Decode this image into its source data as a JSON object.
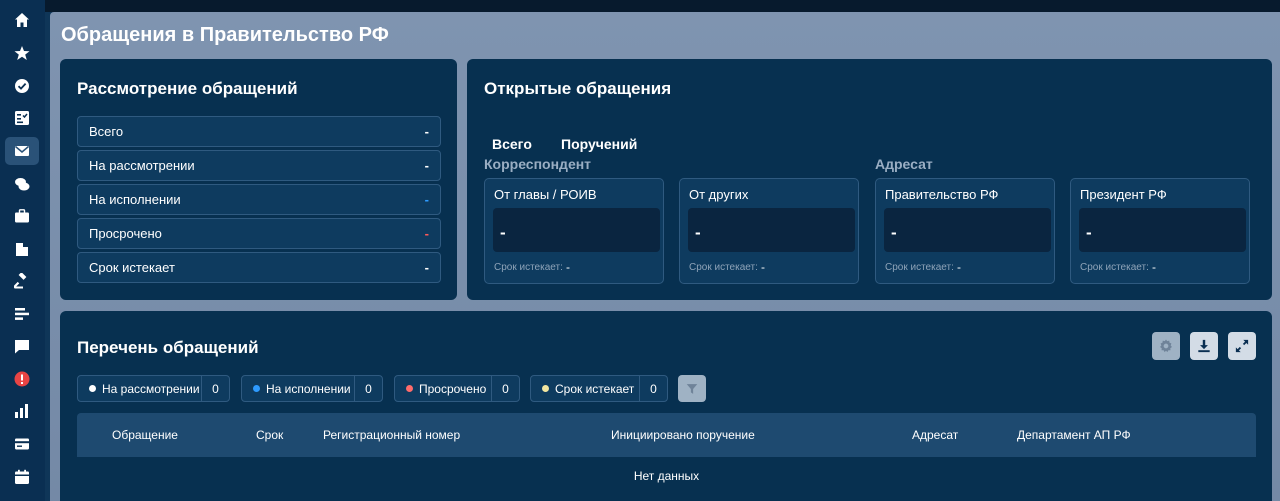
{
  "page_title": "Обращения в Правительство РФ",
  "review_card": {
    "title": "Рассмотрение обращений",
    "rows": [
      {
        "label": "Всего",
        "value": "-",
        "color": "#ffffff"
      },
      {
        "label": "На рассмотрении",
        "value": "-",
        "color": "#ffffff"
      },
      {
        "label": "На исполнении",
        "value": "-",
        "color": "#2e9bff"
      },
      {
        "label": "Просрочено",
        "value": "-",
        "color": "#ff5a5a"
      },
      {
        "label": "Срок истекает",
        "value": "-",
        "color": "#ffffff"
      }
    ]
  },
  "open_card": {
    "title": "Открытые обращения",
    "tabs": [
      "Всего",
      "Поручений"
    ],
    "correspondent_label": "Корреспондент",
    "addressee_label": "Адресат",
    "cards": [
      {
        "title": "От главы / РОИВ",
        "value": "-",
        "deadline_label": "Срок истекает:",
        "deadline_value": "-"
      },
      {
        "title": "От других",
        "value": "-",
        "deadline_label": "Срок истекает:",
        "deadline_value": "-"
      },
      {
        "title": "Правительство РФ",
        "value": "-",
        "deadline_label": "Срок истекает:",
        "deadline_value": "-"
      },
      {
        "title": "Президент РФ",
        "value": "-",
        "deadline_label": "Срок истекает:",
        "deadline_value": "-"
      }
    ]
  },
  "list_card": {
    "title": "Перечень обращений",
    "filters": [
      {
        "label": "На рассмотрении",
        "count": "0",
        "color": "#ffffff"
      },
      {
        "label": "На исполнении",
        "count": "0",
        "color": "#2e9bff"
      },
      {
        "label": "Просрочено",
        "count": "0",
        "color": "#ff6b6b"
      },
      {
        "label": "Срок истекает",
        "count": "0",
        "color": "#f2e6a0"
      }
    ],
    "columns": [
      "Обращение",
      "Срок",
      "Регистрационный номер",
      "Инициировано поручение",
      "Адресат",
      "Департамент АП РФ"
    ],
    "empty_text": "Нет данных"
  },
  "sidebar_icons": [
    "home-icon",
    "star-icon",
    "check-circle-icon",
    "task-list-icon",
    "mail-icon",
    "chat-icon",
    "briefcase-icon",
    "building-icon",
    "gavel-icon",
    "align-icon",
    "message-icon",
    "alert-icon",
    "bar-chart-icon",
    "card-icon",
    "calendar-icon"
  ]
}
